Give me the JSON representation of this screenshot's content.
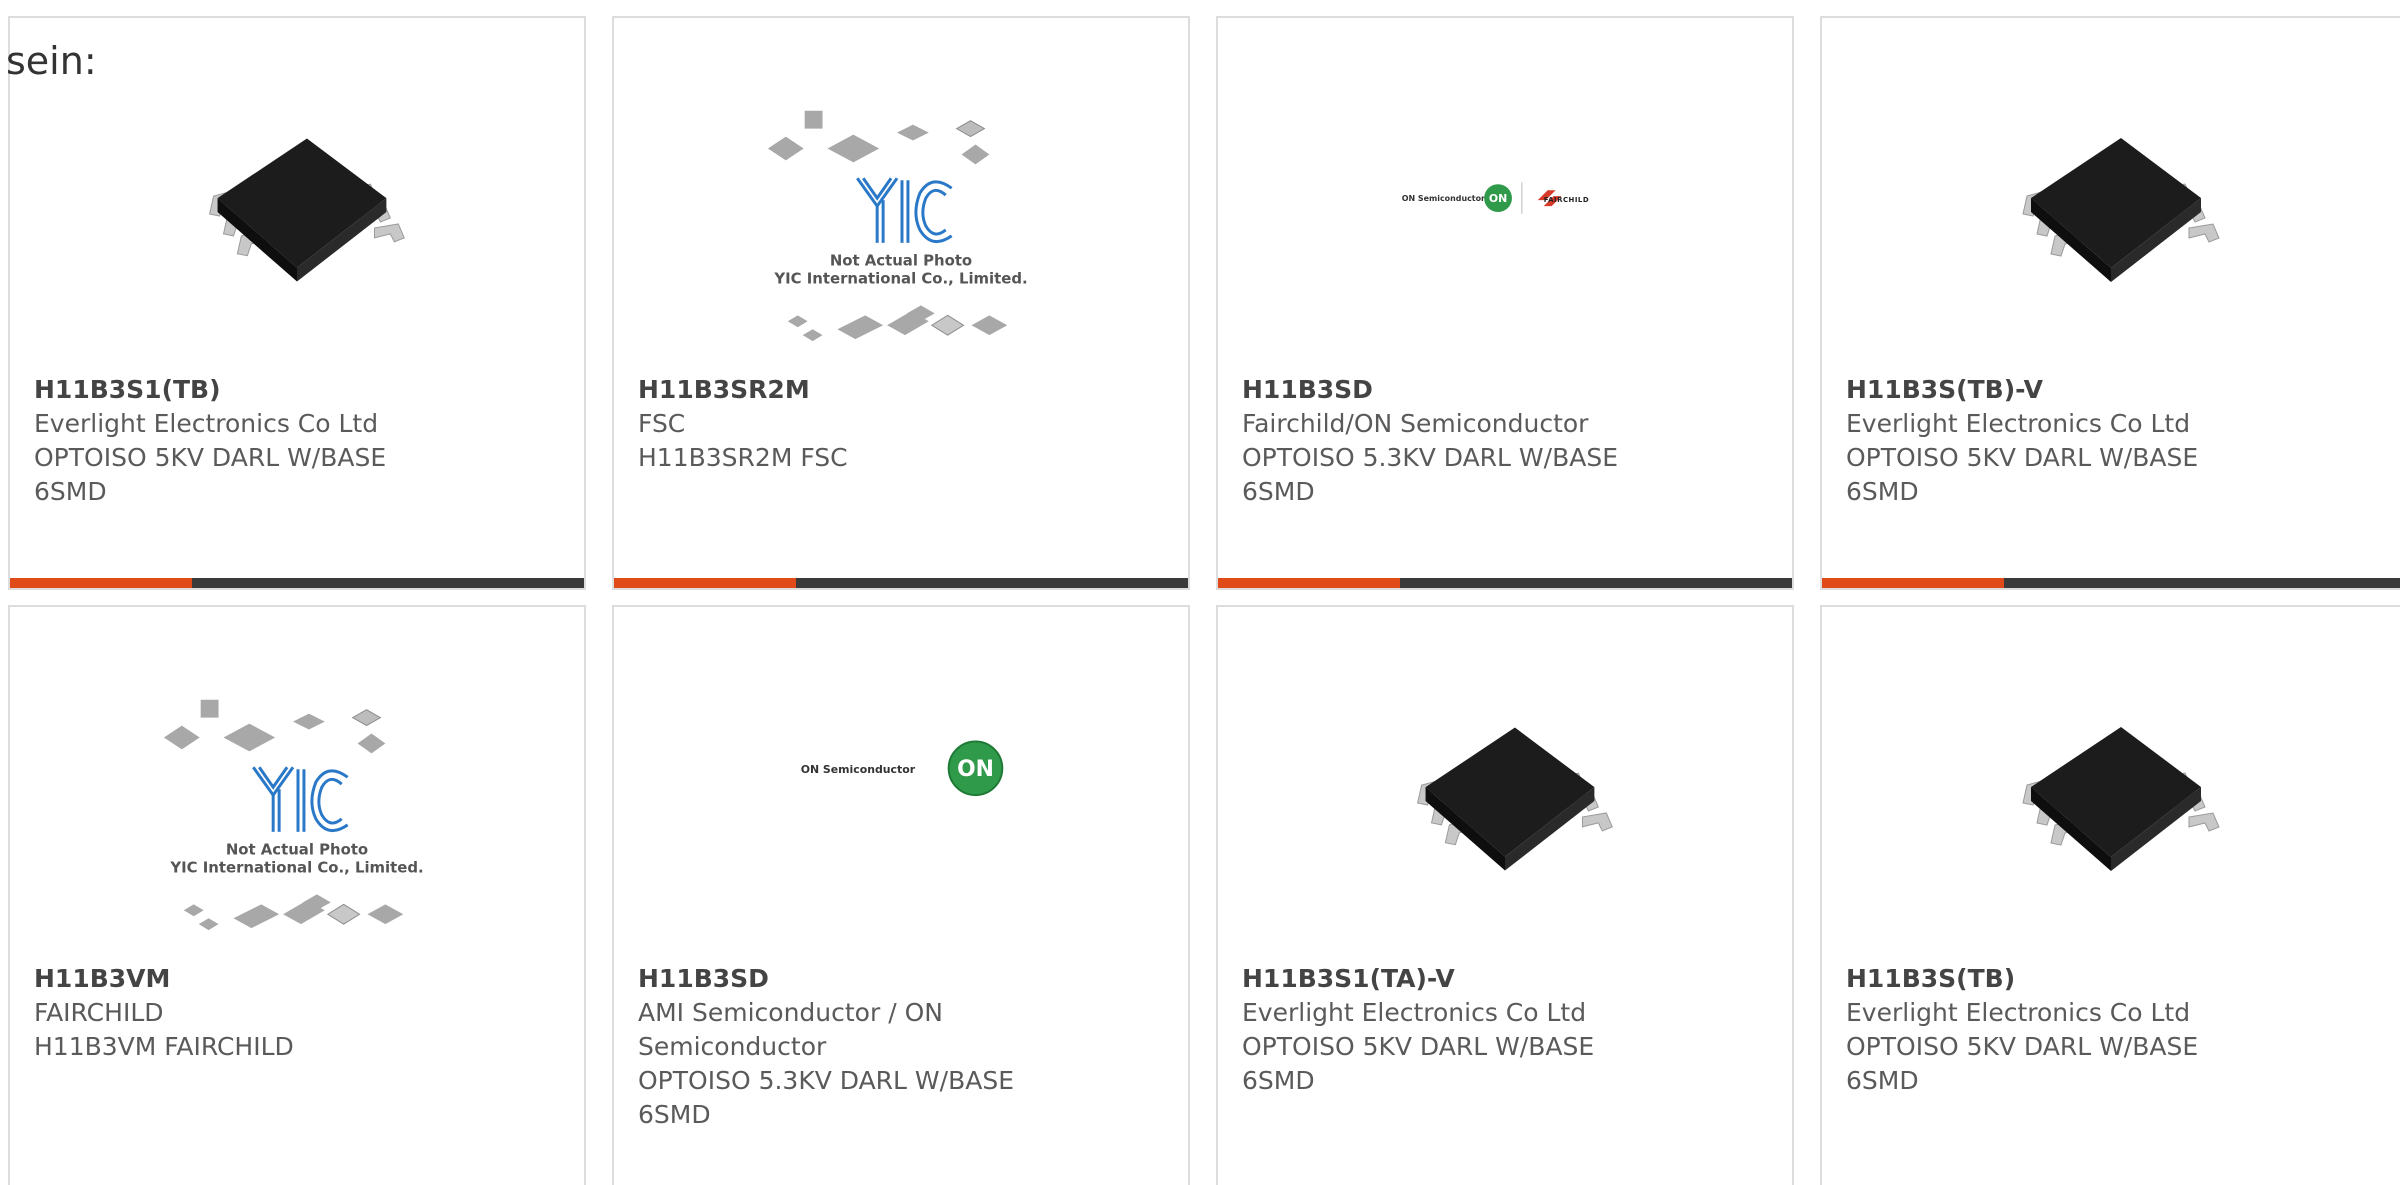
{
  "heading": "sein:",
  "colors": {
    "accent": "#e04a18",
    "bar": "#3a3a3a",
    "border": "#dddddd",
    "text": "#5a5a5a",
    "yic_blue": "#2a78c8",
    "on_green": "#2f9a4a"
  },
  "yic_caption": {
    "line1": "Not Actual Photo",
    "line2": "YIC International Co., Limited."
  },
  "onsemi_text": "ON Semiconductor",
  "cards": [
    {
      "image": "chip-6smd",
      "part": "H11B3S1(TB)",
      "maker": "Everlight Electronics Co Ltd",
      "desc": "OPTOISO 5KV DARL W/BASE",
      "package": "6SMD"
    },
    {
      "image": "yic-placeholder",
      "part": "H11B3SR2M",
      "maker": "FSC",
      "desc": "H11B3SR2M FSC",
      "package": ""
    },
    {
      "image": "on-fairchild-logo",
      "part": "H11B3SD",
      "maker": "Fairchild/ON Semiconductor",
      "desc": "OPTOISO 5.3KV DARL W/BASE",
      "package": "6SMD"
    },
    {
      "image": "chip-6smd",
      "part": "H11B3S(TB)-V",
      "maker": "Everlight Electronics Co Ltd",
      "desc": "OPTOISO 5KV DARL W/BASE",
      "package": "6SMD"
    },
    {
      "image": "yic-placeholder",
      "part": "H11B3VM",
      "maker": "FAIRCHILD",
      "desc": "H11B3VM FAIRCHILD",
      "package": ""
    },
    {
      "image": "onsemi-logo",
      "part": "H11B3SD",
      "maker": "AMI Semiconductor / ON Semiconductor",
      "desc": "OPTOISO 5.3KV DARL W/BASE",
      "package": "6SMD"
    },
    {
      "image": "chip-6smd",
      "part": "H11B3S1(TA)-V",
      "maker": "Everlight Electronics Co Ltd",
      "desc": "OPTOISO 5KV DARL W/BASE",
      "package": "6SMD"
    },
    {
      "image": "chip-6smd",
      "part": "H11B3S(TB)",
      "maker": "Everlight Electronics Co Ltd",
      "desc": "OPTOISO 5KV DARL W/BASE",
      "package": "6SMD"
    }
  ]
}
